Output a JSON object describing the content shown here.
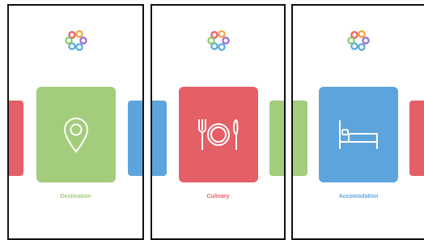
{
  "colors": {
    "green": "#a3cc7c",
    "red": "#e45f66",
    "blue": "#5ea4dc",
    "logo": [
      "#e85a61",
      "#f1a33f",
      "#8bcb6b",
      "#5aa8e0",
      "#9b6bd3"
    ]
  },
  "screens": [
    {
      "label": "Destination",
      "card_color": "green",
      "icon": "map-pin-icon",
      "left_peek": "red",
      "right_peek": "blue"
    },
    {
      "label": "Culinary",
      "card_color": "red",
      "icon": "plate-cutlery-icon",
      "left_peek": "blue",
      "right_peek": "green"
    },
    {
      "label": "Accomodation",
      "card_color": "blue",
      "icon": "bed-icon",
      "left_peek": "green",
      "right_peek": "red"
    }
  ]
}
